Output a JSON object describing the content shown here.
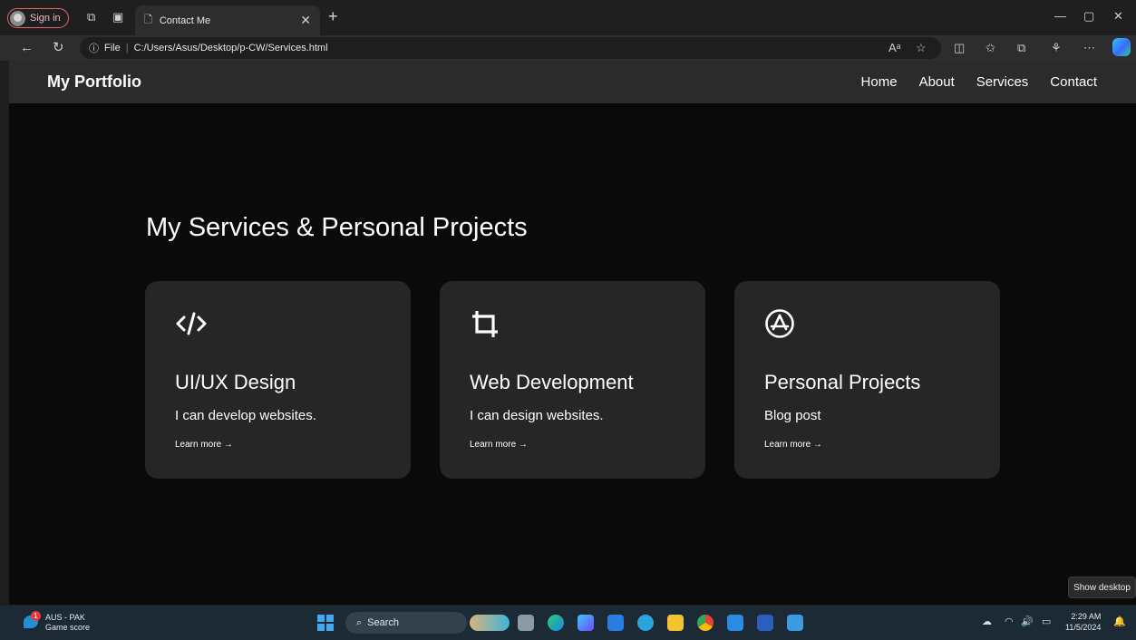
{
  "browser": {
    "signin_label": "Sign in",
    "tab_title": "Contact Me",
    "address_prefix": "File",
    "address": "C:/Users/Asus/Desktop/p-CW/Services.html",
    "tooltip": "Show desktop"
  },
  "site": {
    "brand": "My Portfolio",
    "menu": [
      "Home",
      "About",
      "Services",
      "Contact"
    ],
    "headline": "My Services & Personal Projects",
    "cards": [
      {
        "icon": "code-icon",
        "title": "UI/UX Design",
        "desc": "I can develop websites.",
        "link": "Learn more →"
      },
      {
        "icon": "crop-icon",
        "title": "Web Development",
        "desc": "I can design websites.",
        "link": "Learn more →"
      },
      {
        "icon": "app-store-icon",
        "title": "Personal Projects",
        "desc": "Blog post",
        "link": "Learn more →"
      }
    ]
  },
  "taskbar": {
    "weather_title": "AUS - PAK",
    "weather_sub": "Game score",
    "weather_badge": "1",
    "search_label": "Search",
    "time": "2:29 AM",
    "date": "11/5/2024"
  },
  "colors": {
    "page_bg": "#0a0a0a",
    "nav_bg": "#2b2b2b",
    "card_bg": "#262626",
    "taskbar_bg": "#1c2a35",
    "accent": "#43a8f0"
  }
}
